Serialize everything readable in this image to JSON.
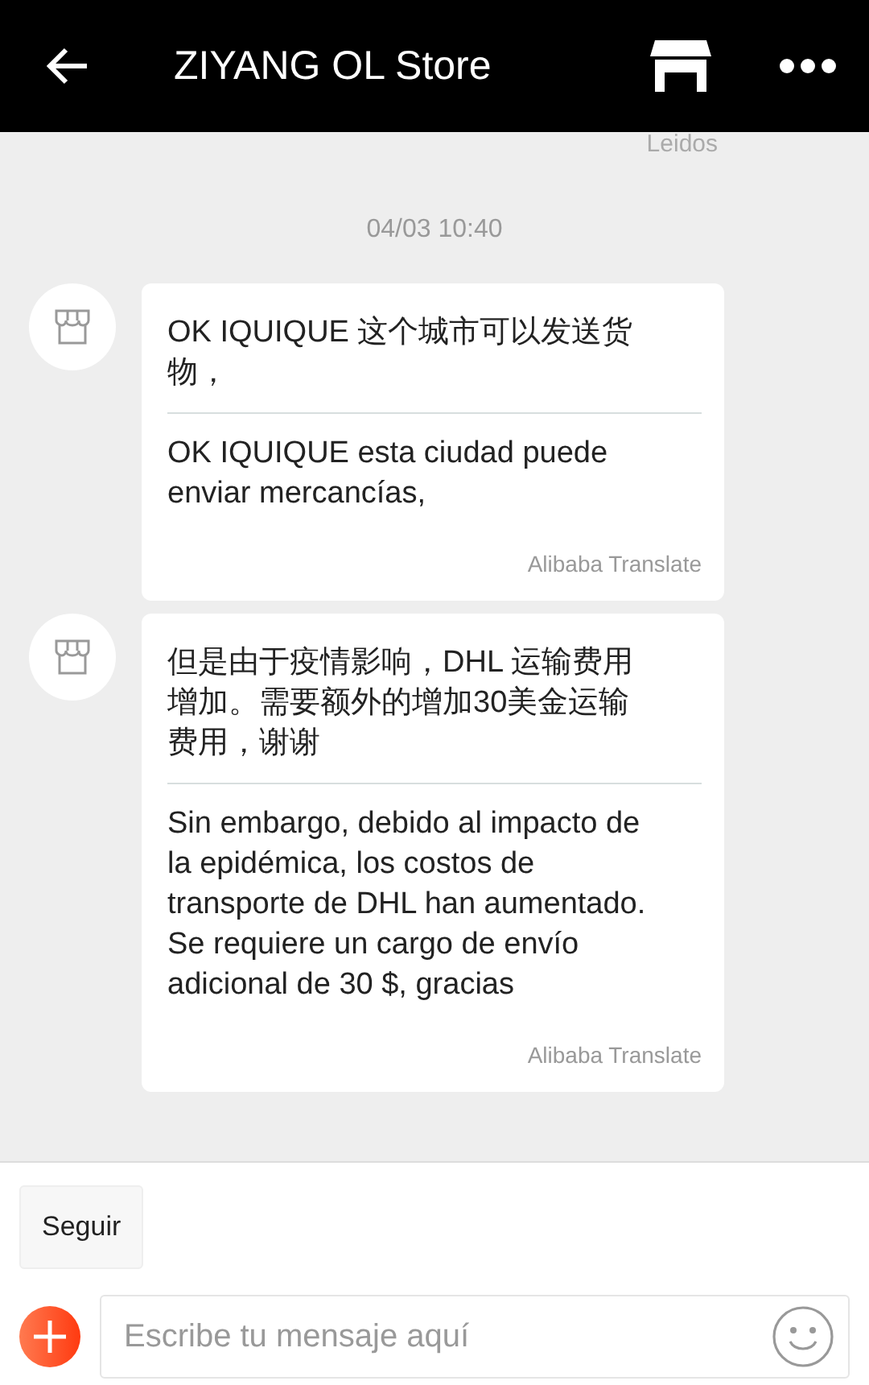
{
  "header": {
    "title": "ZIYANG OL Store"
  },
  "read_receipt": "Leidos",
  "timestamp": "04/03 10:40",
  "messages": [
    {
      "original": "OK IQUIQUE 这个城市可以发送货物，",
      "translation": "OK IQUIQUE esta ciudad puede enviar mercancías,",
      "translator": "Alibaba Translate"
    },
    {
      "original": "但是由于疫情影响，DHL 运输费用增加。需要额外的增加30美金运输费用，谢谢",
      "translation": "Sin embargo, debido al impacto de la epidémica, los costos de transporte de DHL han aumentado. Se requiere un cargo de envío adicional de 30 $, gracias",
      "translator": "Alibaba Translate"
    }
  ],
  "quick_actions": [
    "Seguir"
  ],
  "composer": {
    "placeholder": "Escribe tu mensaje aquí"
  }
}
